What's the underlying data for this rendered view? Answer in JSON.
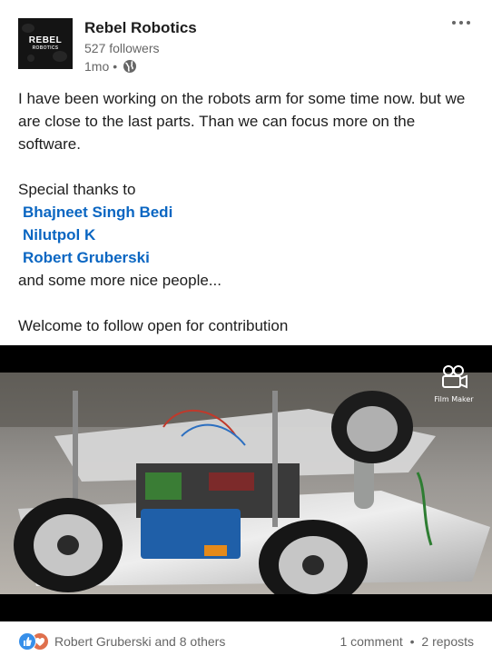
{
  "post": {
    "author": {
      "name": "Rebel Robotics",
      "followers": "527 followers",
      "time": "1mo",
      "visibility_icon": "globe-icon",
      "logo_line1": "REBEL",
      "logo_line2": "ROBOTICS"
    },
    "menu_icon": "more-horizontal-icon",
    "text": {
      "paragraph1": "I have been working on the robots arm for some time now. but we are close to the last parts. Than we can focus more on the software.",
      "thanks_intro": "Special thanks to",
      "mentions": [
        "Bhajneet Singh Bedi",
        "Nilutpol K",
        "Robert Gruberski"
      ],
      "thanks_outro": "and some more nice people...",
      "closing": "Welcome to follow open for contribution"
    },
    "video": {
      "watermark_label": "Film Maker",
      "watermark_icon": "film-camera-icon"
    },
    "social": {
      "reaction_icons": [
        "like-icon",
        "love-icon"
      ],
      "reactors": "Robert Gruberski and 8 others",
      "comments": "1 comment",
      "separator": "•",
      "reposts": "2 reposts"
    }
  },
  "colors": {
    "link": "#0a66c2",
    "text": "#1d1d1d",
    "muted": "#666666",
    "like": "#378fe9",
    "love": "#df704d"
  }
}
